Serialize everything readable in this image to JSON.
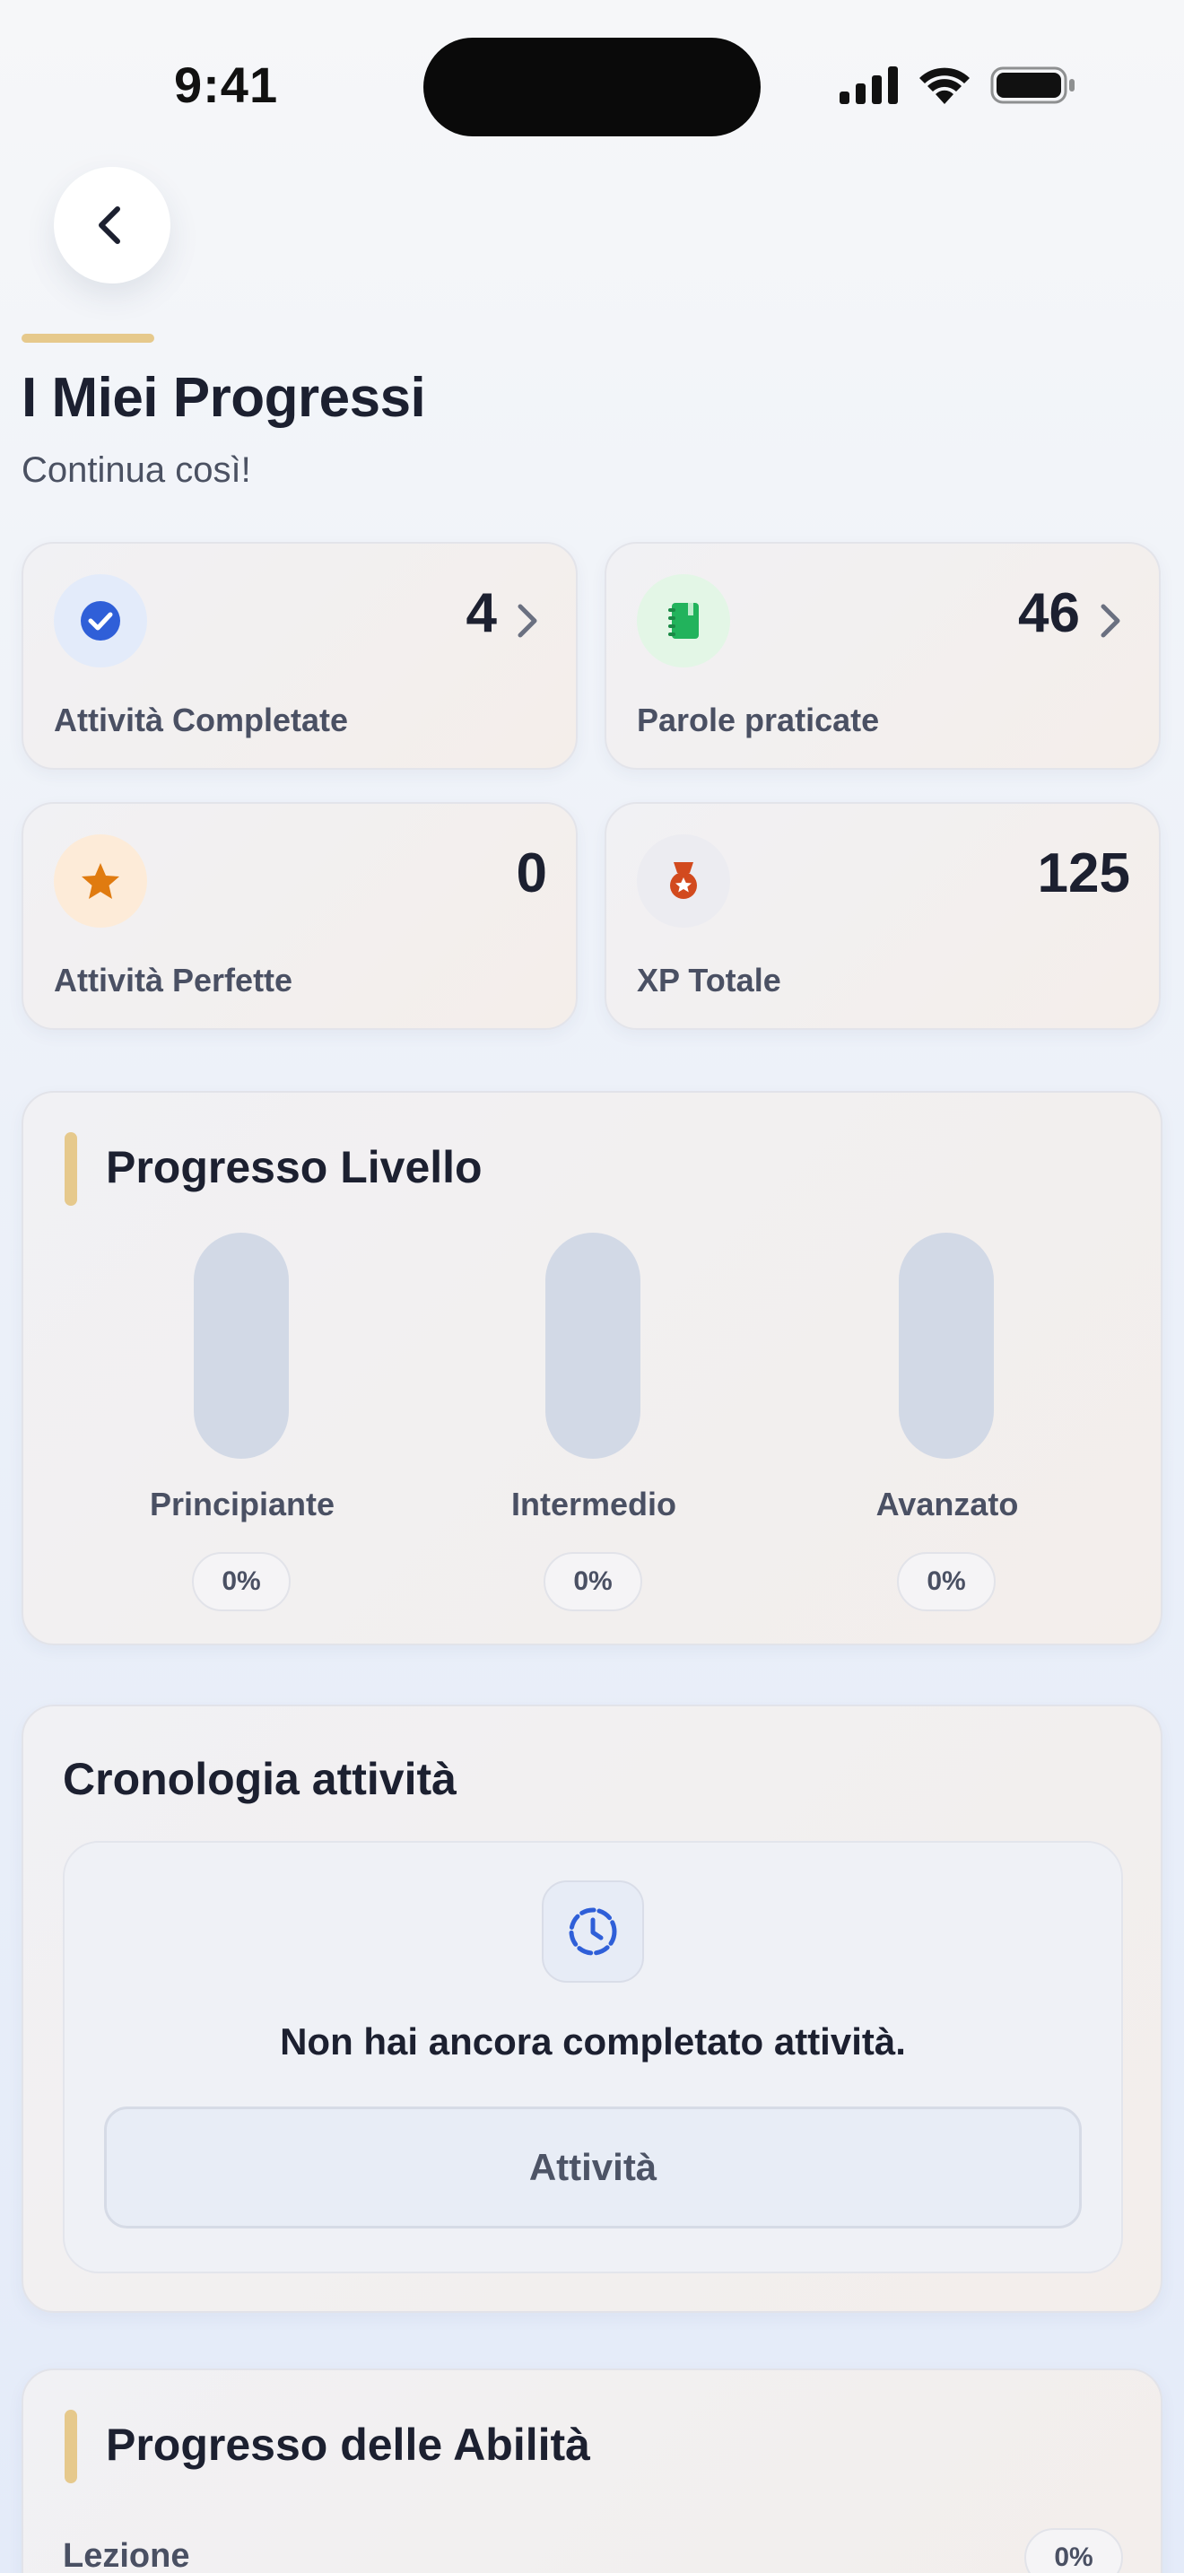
{
  "status_bar": {
    "time": "9:41"
  },
  "header": {
    "back_icon": "chevron-left-icon",
    "title": "I Miei Progressi",
    "subtitle": "Continua così!",
    "accent_color": "#e6c98c"
  },
  "stats": [
    {
      "value": "4",
      "label": "Attività Completate",
      "icon": "check-circle-icon",
      "icon_color": "#2f5fd8",
      "icon_bg": "#e3ebfa",
      "has_chevron": true
    },
    {
      "value": "46",
      "label": "Parole praticate",
      "icon": "notebook-icon",
      "icon_color": "#22b35c",
      "icon_bg": "#e3f6e6",
      "has_chevron": true
    },
    {
      "value": "0",
      "label": "Attività Perfette",
      "icon": "star-icon",
      "icon_color": "#e07b10",
      "icon_bg": "#fdebd8",
      "has_chevron": false
    },
    {
      "value": "125",
      "label": "XP Totale",
      "icon": "medal-icon",
      "icon_color": "#d24a1e",
      "icon_bg": "#ececf1",
      "has_chevron": false
    }
  ],
  "level_progress": {
    "title": "Progresso Livello",
    "levels": [
      {
        "label": "Principiante",
        "percent_text": "0%",
        "fraction": 0
      },
      {
        "label": "Intermedio",
        "percent_text": "0%",
        "fraction": 0
      },
      {
        "label": "Avanzato",
        "percent_text": "0%",
        "fraction": 0
      }
    ]
  },
  "history": {
    "title": "Cronologia attività",
    "empty_icon": "clock-history-icon",
    "empty_message": "Non hai ancora completato attività.",
    "button_label": "Attività"
  },
  "skills": {
    "title": "Progresso delle Abilità",
    "items": [
      {
        "label": "Lezione",
        "percent_text": "0%"
      }
    ]
  }
}
